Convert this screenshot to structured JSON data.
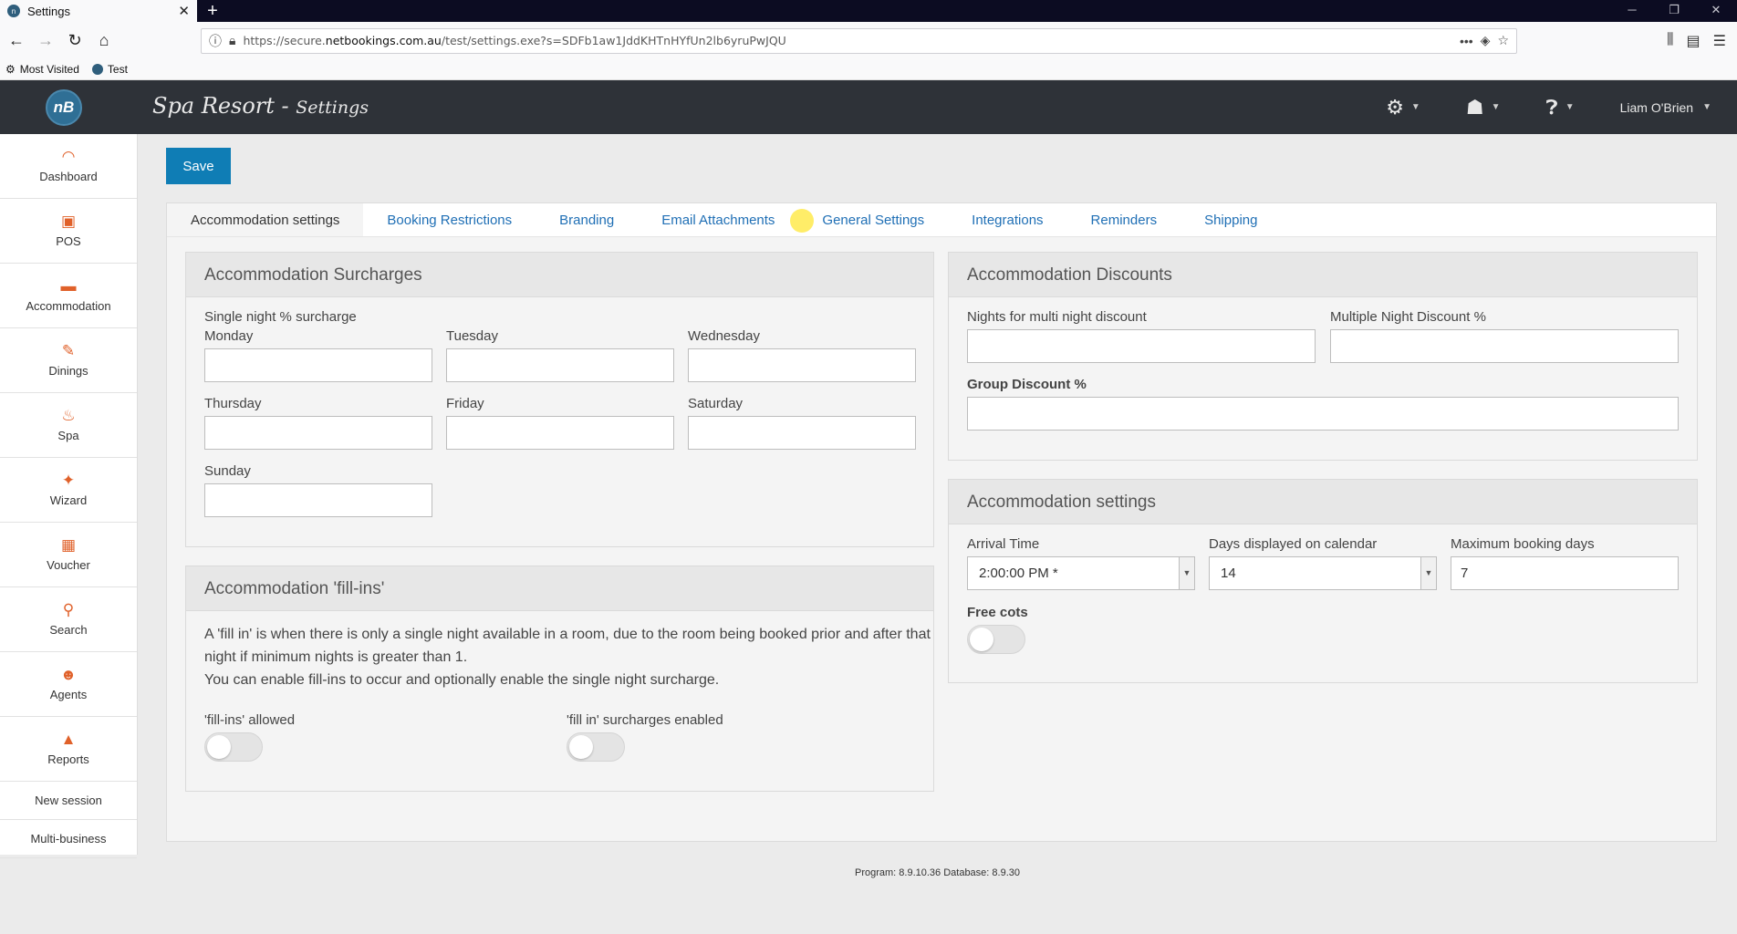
{
  "browser": {
    "tab_title": "Settings",
    "url_prefix": "https://secure.",
    "url_domain": "netbookings.com.au",
    "url_path": "/test/settings.exe?s=SDFb1aw1JddKHTnHYfUn2lb6yruPwJQU",
    "bookmarks": [
      "Most Visited",
      "Test"
    ]
  },
  "header": {
    "logo_text": "nB",
    "title": "Spa Resort",
    "subtitle": "Settings",
    "user_name": "Liam O'Brien"
  },
  "sidebar": {
    "items": [
      {
        "label": "Dashboard",
        "icon": "dashboard-icon",
        "glyph": "◠"
      },
      {
        "label": "POS",
        "icon": "pos-icon",
        "glyph": "▣"
      },
      {
        "label": "Accommodation",
        "icon": "bed-icon",
        "glyph": "▬"
      },
      {
        "label": "Dinings",
        "icon": "dining-icon",
        "glyph": "✎"
      },
      {
        "label": "Spa",
        "icon": "spa-icon",
        "glyph": "♨"
      },
      {
        "label": "Wizard",
        "icon": "wand-icon",
        "glyph": "✦"
      },
      {
        "label": "Voucher",
        "icon": "gift-icon",
        "glyph": "▦"
      },
      {
        "label": "Search",
        "icon": "search-icon",
        "glyph": "⚲"
      },
      {
        "label": "Agents",
        "icon": "agent-icon",
        "glyph": "☻"
      },
      {
        "label": "Reports",
        "icon": "chart-icon",
        "glyph": "▲"
      }
    ],
    "links": [
      "New session",
      "Multi-business"
    ]
  },
  "toolbar": {
    "save_label": "Save"
  },
  "tabs": [
    "Accommodation settings",
    "Booking Restrictions",
    "Branding",
    "Email Attachments",
    "General Settings",
    "Integrations",
    "Reminders",
    "Shipping"
  ],
  "surcharges": {
    "title": "Accommodation Surcharges",
    "caption": "Single night % surcharge",
    "days": [
      "Monday",
      "Tuesday",
      "Wednesday",
      "Thursday",
      "Friday",
      "Saturday",
      "Sunday"
    ]
  },
  "fillins": {
    "title": "Accommodation 'fill-ins'",
    "line1": "A 'fill in' is when there is only a single night available in a room, due to the room being booked prior and after that night if minimum nights is greater than 1.",
    "line2": "You can enable fill-ins to occur and optionally enable the single night surcharge.",
    "allowed_label": "'fill-ins' allowed",
    "surcharges_label": "'fill in' surcharges enabled"
  },
  "discounts": {
    "title": "Accommodation Discounts",
    "multi_nights_label": "Nights for multi night discount",
    "multi_discount_label": "Multiple Night Discount %",
    "group_label": "Group Discount %"
  },
  "acc_settings": {
    "title": "Accommodation settings",
    "arrival_label": "Arrival Time",
    "arrival_value": "2:00:00 PM *",
    "days_label": "Days displayed on calendar",
    "days_value": "14",
    "max_label": "Maximum booking days",
    "max_value": "7",
    "free_cots_label": "Free cots"
  },
  "footer": {
    "version": "Program: 8.9.10.36 Database: 8.9.30"
  }
}
